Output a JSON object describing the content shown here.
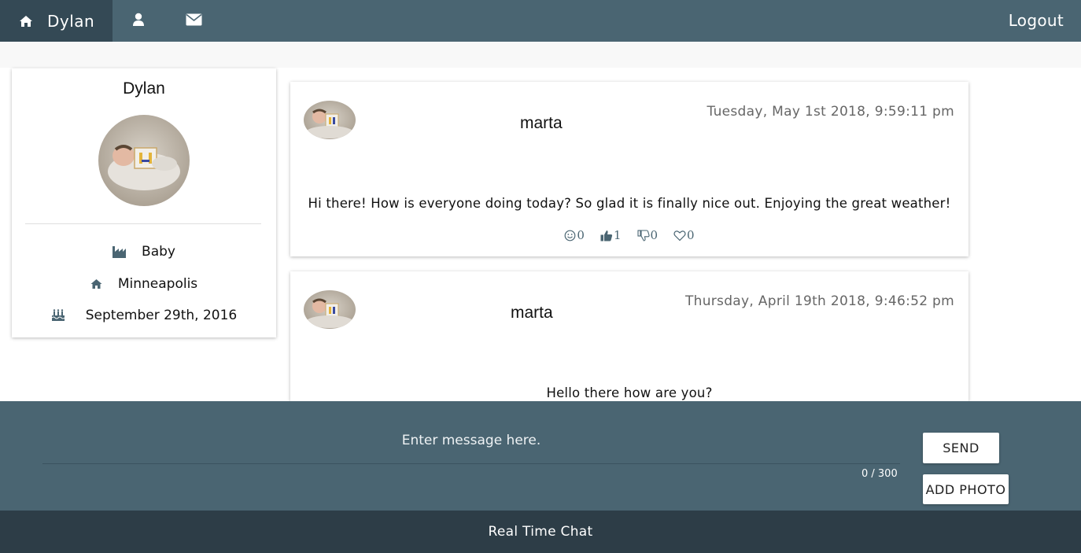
{
  "nav": {
    "home_icon": "home-icon",
    "user_name": "Dylan",
    "profile_icon": "user-icon",
    "messages_icon": "envelope-icon",
    "logout": "Logout"
  },
  "profile": {
    "name": "Dylan",
    "avatar": "baby-photo",
    "occupation_icon": "industry-icon",
    "occupation": "Baby",
    "location_icon": "home-icon",
    "location": "Minneapolis",
    "birthday_icon": "birthday-cake-icon",
    "birthday": "September 29th, 2016"
  },
  "posts": [
    {
      "author": "marta",
      "date": "Tuesday, May 1st 2018, 9:59:11 pm",
      "body": "Hi there! How is everyone doing today? So glad it is finally nice out. Enjoying the great weather!",
      "reactions": {
        "smile": "0",
        "like": "1",
        "dislike": "0",
        "love": "0"
      }
    },
    {
      "author": "marta",
      "date": "Thursday, April 19th 2018, 9:46:52 pm",
      "body": "Hello there how are you?"
    }
  ],
  "composer": {
    "placeholder": "Enter message here.",
    "counter": "0 / 300",
    "send": "SEND",
    "add_photo": "ADD PHOTO"
  },
  "footer": {
    "title": "Real Time Chat"
  },
  "colors": {
    "primary": "#4a6572",
    "primary_dark": "#344955",
    "footer": "#2d3d47"
  }
}
